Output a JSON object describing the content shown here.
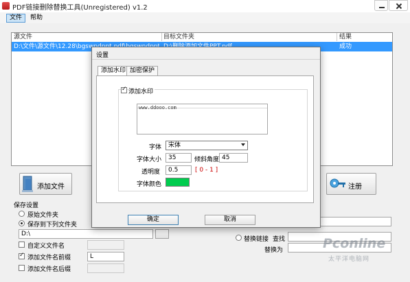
{
  "window": {
    "title": "PDF链接删除替换工具(Unregistered) v1.2",
    "menu": [
      "文件",
      "帮助"
    ]
  },
  "table": {
    "columns": [
      "源文件",
      "目标文件夹",
      "结果"
    ],
    "rows": [
      [
        "D:\\文件\\源文件\\12.28\\bgswndppt.pdf\\bgswndppt风格选",
        "D:\\删除添加文件PPT.pdf",
        "成功"
      ]
    ]
  },
  "buttons": {
    "add_file": "添加文件",
    "register": "注册"
  },
  "save_settings": {
    "title": "保存设置",
    "opt_original": "原始文件夹",
    "opt_save_to": "保存到下列文件夹",
    "path_value": "D:\\",
    "custom_name": "自定义文件名",
    "prefix_label": "添加文件名前缀",
    "prefix_value": "L",
    "suffix_label": "添加文件名后缀"
  },
  "replace_link": {
    "label": "替换链接",
    "find": "查找",
    "replace_with": "替换为"
  },
  "watermark_brand": {
    "main": "Pconline",
    "sub": "太平洋电脑网"
  },
  "dialog": {
    "title": "设置",
    "tabs": [
      "添加水印",
      "加密保护"
    ],
    "add_watermark": "添加水印",
    "watermark_text": "www.ddooo.com",
    "font_label": "字体",
    "font_value": "宋体",
    "size_label": "字体大小",
    "size_value": "35",
    "angle_label": "倾斜角度",
    "angle_value": "45",
    "opacity_label": "透明度",
    "opacity_value": "0.5",
    "opacity_range": "[ 0 - 1 ]",
    "color_label": "字体颜色",
    "color_value": "#00cc4e",
    "ok": "确定",
    "cancel": "取消"
  }
}
